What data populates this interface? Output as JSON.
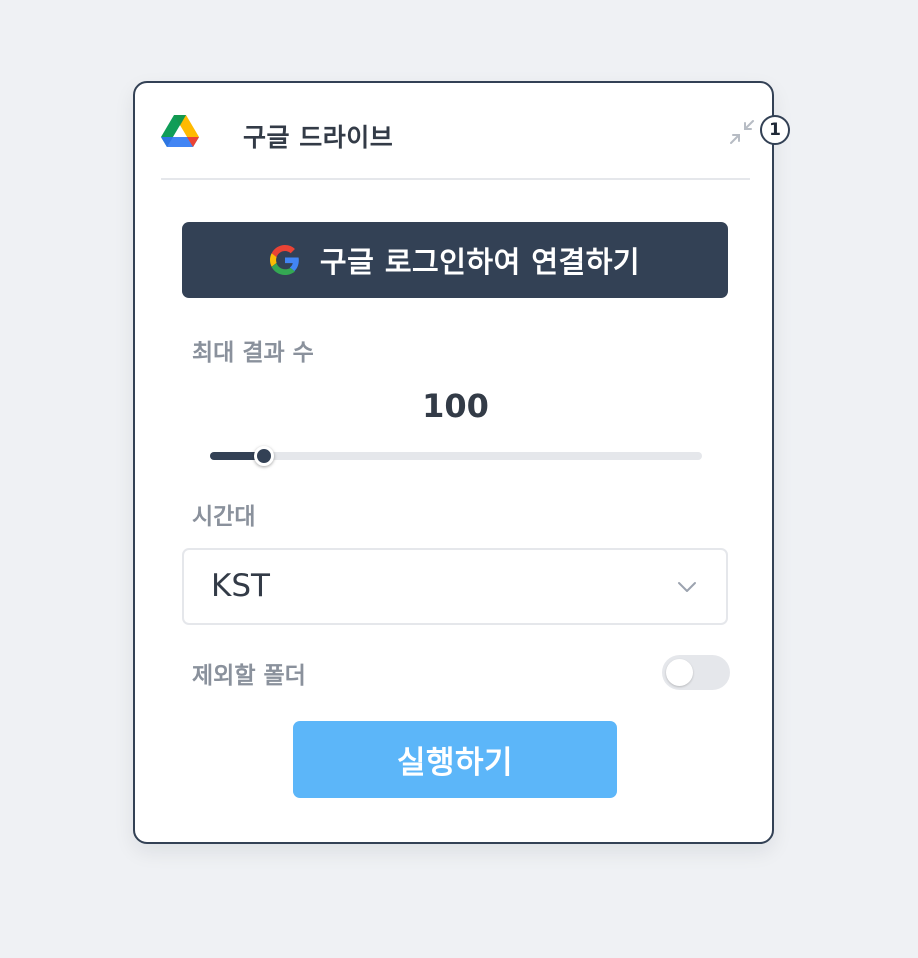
{
  "node": {
    "title": "구글 드라이브",
    "icon": "google-drive-icon",
    "collapse_icon": "collapse-icon"
  },
  "login_button": {
    "label": "구글 로그인하여 연결하기",
    "icon": "google-g-icon"
  },
  "max_results": {
    "label": "최대 결과 수",
    "value": "100",
    "fraction": 0.11
  },
  "timezone": {
    "label": "시간대",
    "selected": "KST",
    "icon": "chevron-down-icon"
  },
  "exclude_folders": {
    "label": "제외할 폴더",
    "enabled": false
  },
  "run_button": {
    "label": "실행하기"
  },
  "badge": {
    "number": "1"
  },
  "colors": {
    "background": "#eff1f4",
    "card_border": "#334155",
    "dark_button": "#334155",
    "run_button": "#5cb6f9",
    "muted_label": "#8a919c",
    "track": "#e5e7eb"
  }
}
